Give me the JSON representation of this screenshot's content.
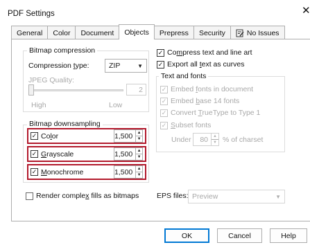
{
  "window": {
    "title": "PDF Settings",
    "close_glyph": "✕"
  },
  "tabs": [
    {
      "label": "General",
      "active": false
    },
    {
      "label": "Color",
      "active": false
    },
    {
      "label": "Document",
      "active": false
    },
    {
      "label": "Objects",
      "active": true
    },
    {
      "label": "Prepress",
      "active": false
    },
    {
      "label": "Security",
      "active": false
    },
    {
      "label": "No Issues",
      "active": false,
      "icon": "report-icon"
    }
  ],
  "bitmap_compression": {
    "group_label": "Bitmap compression",
    "type_label_pre": "Compression ",
    "type_label_u": "t",
    "type_label_post": "ype:",
    "type_value": "ZIP",
    "jpeg_quality_label": "JPEG Quality:",
    "jpeg_quality_value": "2",
    "slider_low_label": "High",
    "slider_high_label": "Low",
    "slider_fraction": 0.0
  },
  "bitmap_downsampling": {
    "group_label": "Bitmap downsampling",
    "rows": [
      {
        "pre": "Co",
        "u": "l",
        "post": "or",
        "checked": true,
        "value": "1,500"
      },
      {
        "pre": "",
        "u": "G",
        "post": "rayscale",
        "checked": true,
        "value": "1,500"
      },
      {
        "pre": "",
        "u": "M",
        "post": "onochrome",
        "checked": true,
        "value": "1,500"
      }
    ]
  },
  "render_complex": {
    "pre": "Render comple",
    "u": "x",
    "post": " fills as bitmaps",
    "checked": false
  },
  "right": {
    "compress_text": {
      "pre": "Co",
      "u": "m",
      "post": "press text and line art",
      "checked": true
    },
    "export_curves": {
      "pre": "Export all ",
      "u": "t",
      "post": "ext as curves",
      "checked": true
    },
    "text_fonts_label": "Text and fonts",
    "embed_fonts": {
      "pre": "Embed ",
      "u": "f",
      "post": "onts in document",
      "checked": true
    },
    "embed_base14": {
      "pre": "Embed ",
      "u": "b",
      "post": "ase 14 fonts",
      "checked": true
    },
    "convert_truetype": {
      "pre": "Convert ",
      "u": "T",
      "post": "rueType to Type 1",
      "checked": true
    },
    "subset_fonts": {
      "pre": "",
      "u": "S",
      "post": "ubset fonts",
      "checked": true
    },
    "under_label": "Under",
    "under_value": "80",
    "percent_label": "% of charset"
  },
  "eps": {
    "label": "EPS files:",
    "value": "Preview"
  },
  "buttons": {
    "ok": "OK",
    "cancel": "Cancel",
    "help": "Help"
  },
  "colors": {
    "highlight": "#b2182b",
    "primary_border": "#0078d4"
  },
  "check_glyph": "✓"
}
